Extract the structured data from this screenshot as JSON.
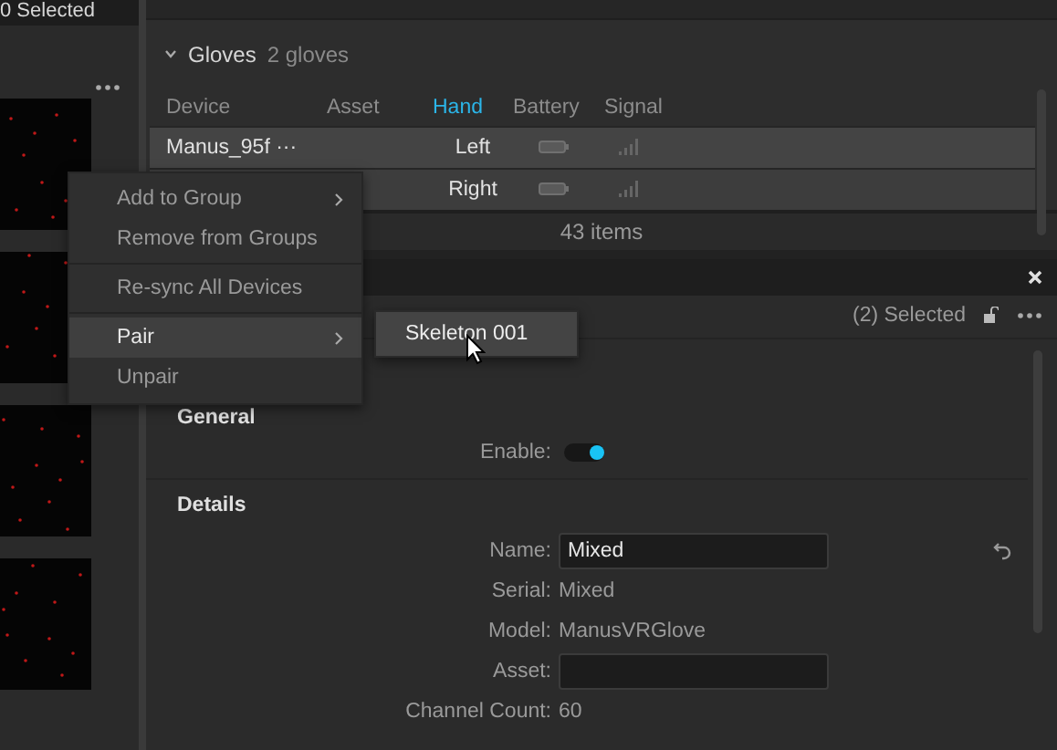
{
  "left_panel": {
    "status": "0 Selected"
  },
  "devices": {
    "group": {
      "title": "Gloves",
      "count": "2 gloves",
      "expanded": true
    },
    "columns": [
      {
        "label": "Device",
        "selected": false
      },
      {
        "label": "Asset",
        "selected": false
      },
      {
        "label": "Hand",
        "selected": true
      },
      {
        "label": "Battery",
        "selected": false
      },
      {
        "label": "Signal",
        "selected": false
      }
    ],
    "rows": [
      {
        "device": "Manus_95f ···",
        "hand": "Left"
      },
      {
        "hand": "Right"
      }
    ],
    "footer": "43 items"
  },
  "properties": {
    "selected_count": "(2) Selected",
    "sections": [
      {
        "title": "General",
        "fields": [
          {
            "kind": "toggle",
            "label": "Enable:",
            "on": true
          }
        ]
      },
      {
        "title": "Details",
        "fields": [
          {
            "kind": "input",
            "label": "Name:",
            "value": "Mixed",
            "revertable": true
          },
          {
            "kind": "text",
            "label": "Serial:",
            "value": "Mixed"
          },
          {
            "kind": "text",
            "label": "Model:",
            "value": "ManusVRGlove"
          },
          {
            "kind": "input",
            "label": "Asset:"
          },
          {
            "kind": "text",
            "label": "Channel Count:",
            "value": "60"
          }
        ]
      }
    ]
  },
  "context_menu": {
    "groups": [
      [
        {
          "label": "Add to Group",
          "submenu": true,
          "highlighted": false
        },
        {
          "label": "Remove from Groups",
          "submenu": false,
          "highlighted": false
        }
      ],
      [
        {
          "label": "Re-sync All Devices",
          "submenu": false,
          "highlighted": false
        }
      ],
      [
        {
          "label": "Pair",
          "submenu": true,
          "highlighted": true
        },
        {
          "label": "Unpair",
          "submenu": false,
          "highlighted": false
        }
      ]
    ],
    "submenu": [
      {
        "label": "Skeleton 001",
        "highlighted": true
      }
    ]
  }
}
